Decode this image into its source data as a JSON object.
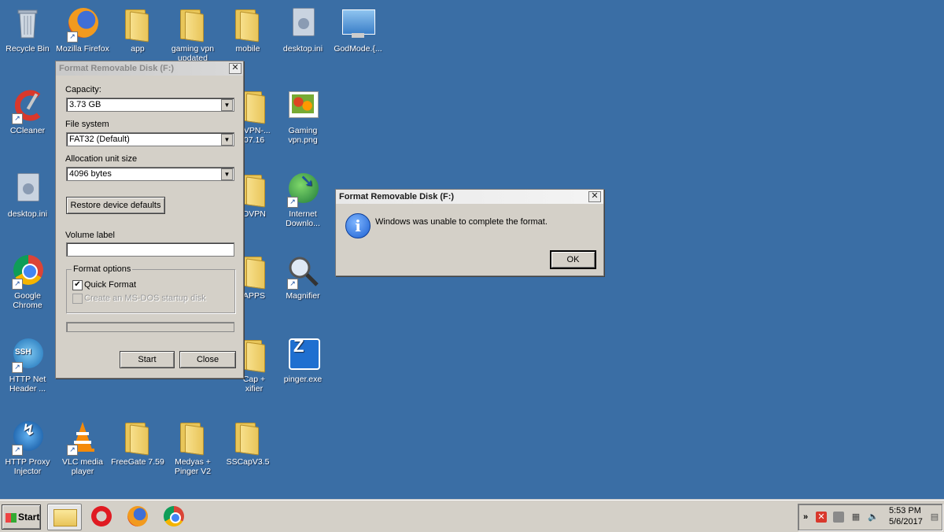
{
  "desktop": {
    "icons": [
      {
        "label": "Recycle Bin"
      },
      {
        "label": "Mozilla Firefox"
      },
      {
        "label": "app"
      },
      {
        "label": "gaming vpn\nupdated"
      },
      {
        "label": "mobile"
      },
      {
        "label": "desktop.ini"
      },
      {
        "label": "GodMode.{..."
      },
      {
        "label": "CCleaner"
      },
      {
        "label": "CVPN-...\n07.16"
      },
      {
        "label": "Gaming\nvpn.png"
      },
      {
        "label": "desktop.ini"
      },
      {
        "label": "OVPN"
      },
      {
        "label": "Internet\nDownlo..."
      },
      {
        "label": "Google\nChrome"
      },
      {
        "label": "APPS"
      },
      {
        "label": "Magnifier"
      },
      {
        "label": "HTTP Net\nHeader ..."
      },
      {
        "label": "Cap +\nxifier"
      },
      {
        "label": "pinger.exe"
      },
      {
        "label": "HTTP Proxy\nInjector"
      },
      {
        "label": "VLC media\nplayer"
      },
      {
        "label": "FreeGate 7.59"
      },
      {
        "label": "Medyas +\nPinger V2"
      },
      {
        "label": "SSCapV3.5"
      }
    ]
  },
  "format_dialog": {
    "title": "Format Removable Disk (F:)",
    "capacity_label": "Capacity:",
    "capacity_value": "3.73 GB",
    "filesystem_label": "File system",
    "filesystem_value": "FAT32 (Default)",
    "alloc_label": "Allocation unit size",
    "alloc_value": "4096 bytes",
    "restore_button": "Restore device defaults",
    "volume_label": "Volume label",
    "volume_value": "",
    "options_legend": "Format options",
    "quick_format": "Quick Format",
    "quick_format_checked": true,
    "msdos_disk": "Create an MS-DOS startup disk",
    "msdos_checked": false,
    "progress": 0,
    "start_button": "Start",
    "close_button": "Close",
    "close_icon": "✕"
  },
  "message_box": {
    "title": "Format Removable Disk (F:)",
    "message": "Windows was unable to complete the format.",
    "ok_button": "OK",
    "icon": "i",
    "close_icon": "✕"
  },
  "taskbar": {
    "start_label": "Start",
    "pinned": [
      "windows-explorer",
      "opera",
      "firefox",
      "chrome"
    ],
    "tray_expand": "»",
    "clock_time": "5:53 PM",
    "clock_date": "5/6/2017"
  }
}
